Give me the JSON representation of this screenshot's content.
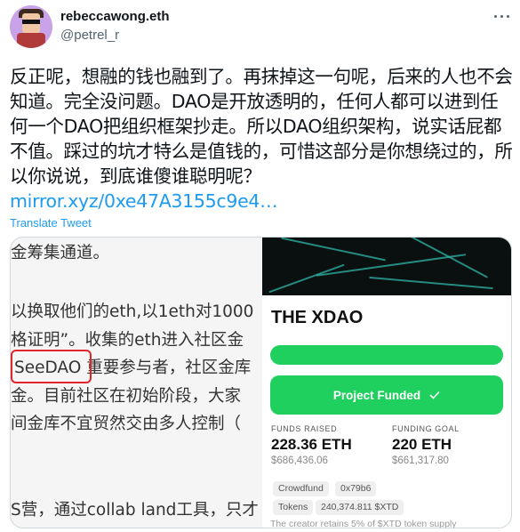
{
  "author": {
    "display_name": "rebeccawong.eth",
    "handle": "@petrel_r"
  },
  "tweet": {
    "text": "反正呢，想融的钱也融到了。再抹掉这一句呢，后来的人也不会知道。完全没问题。DAO是开放透明的，任何人都可以进到任何一个DAO把组织框架抄走。所以DAO组织架构，说实话屁都不值。踩过的坑才特么是值钱的，可惜这部分是你想绕过的，所以你说说，到底谁傻谁聪明呢？",
    "link": "mirror.xyz/0xe47A3155c9e4…",
    "translate": "Translate Tweet"
  },
  "media": {
    "doc_lines": [
      "金筹集通道。",
      "以换取他们的eth,以1eth对1000",
      "格证明”。收集的eth进入社区金",
      "SeeDAO 重要参与者，社区金库",
      "金。目前社区在初始阶段，大家",
      "间金库不宜贸然交由多人控制（",
      "S营，通过collab land工具，只才"
    ],
    "card": {
      "title": "THE XDAO",
      "funded_button": "Project Funded",
      "check_icon": "check-icon",
      "funds_raised_label": "FUNDS RAISED",
      "funds_raised_value": "228.36 ETH",
      "funds_raised_usd": "$686,436.06",
      "funding_goal_label": "FUNDING GOAL",
      "funding_goal_value": "220 ETH",
      "funding_goal_usd": "$661,317.80",
      "chips": [
        "Crowdfund",
        "0x79b6",
        "Tokens",
        "240,374.811 $XTD"
      ],
      "fine_print": "The creator retains 5% of $XTD token supply",
      "progress": 1.0,
      "accent_color": "#1fd05f"
    }
  },
  "colors": {
    "link": "#1d9bf0",
    "secondary_text": "#536471",
    "highlight_box": "#e0252b"
  }
}
